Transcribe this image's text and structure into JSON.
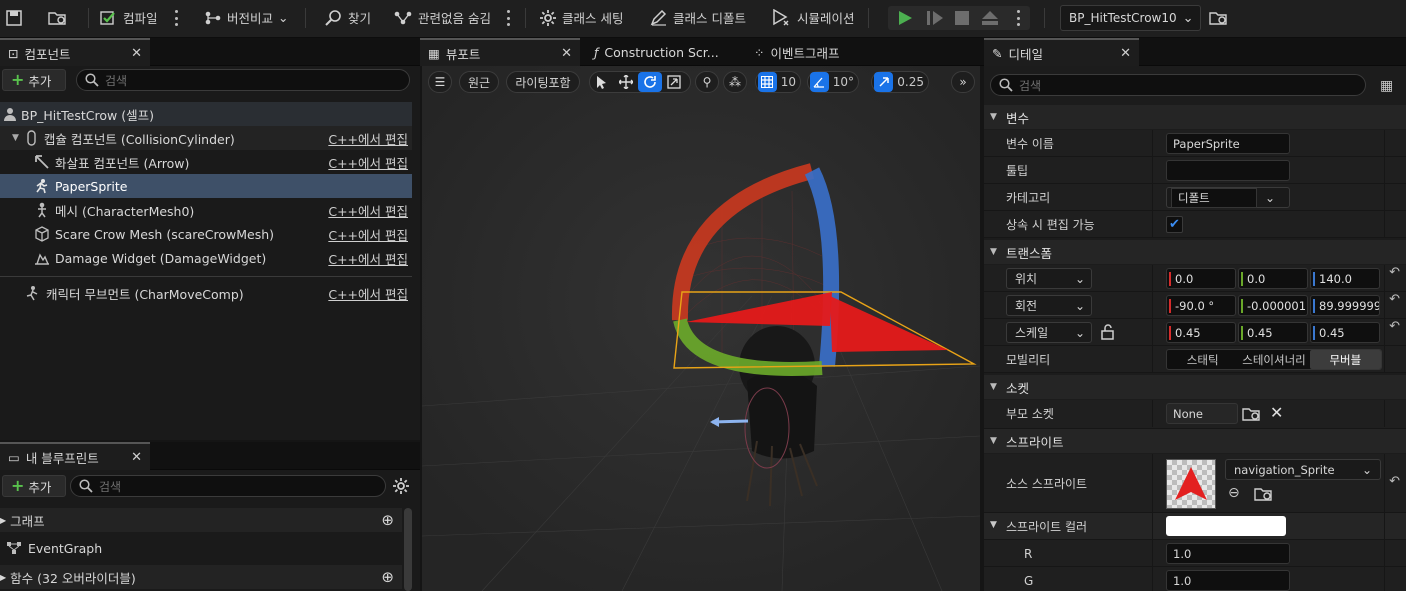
{
  "toolbar": {
    "compile": "컴파일",
    "diff": "버전비교",
    "find": "찾기",
    "hide_unrelated": "관련없음 숨김",
    "class_settings": "클래스 세팅",
    "class_defaults": "클래스 디폴트",
    "simulation": "시뮬레이션",
    "debug_object": "BP_HitTestCrow10"
  },
  "components_panel": {
    "tab_label": "컴포넌트",
    "add_label": "추가",
    "search_placeholder": "검색",
    "root_item": "BP_HitTestCrow (셀프)",
    "edit_label": "C++에서 편집",
    "items": [
      {
        "label": "캡슐 컴포넌트 (CollisionCylinder)",
        "edit": "C++에서 편집"
      },
      {
        "label": "화살표 컴포넌트 (Arrow)",
        "edit": "C++에서 편집"
      },
      {
        "label": "PaperSprite",
        "edit": ""
      },
      {
        "label": "메시 (CharacterMesh0)",
        "edit": "C++에서 편집"
      },
      {
        "label": "Scare Crow Mesh (scareCrowMesh)",
        "edit": "C++에서 편집"
      },
      {
        "label": "Damage Widget (DamageWidget)",
        "edit": "C++에서 편집"
      },
      {
        "label": "캐릭터 무브먼트 (CharMoveComp)",
        "edit": "C++에서 편집"
      }
    ]
  },
  "blueprint_panel": {
    "tab_label": "내 블루프린트",
    "add_label": "추가",
    "search_placeholder": "검색",
    "graph_section": "그래프",
    "event_graph": "EventGraph",
    "functions_section": "함수 (32 오버라이더블)"
  },
  "editor_tabs": {
    "viewport": "뷰포트",
    "construction": "Construction Scr...",
    "event_graph": "이벤트그래프"
  },
  "viewport_toolbar": {
    "perspective": "원근",
    "lighting": "라이팅포함",
    "grid_snap": "10",
    "rotation_snap": "10°",
    "scale_snap": "0.25"
  },
  "details": {
    "tab_label": "디테일",
    "search_placeholder": "검색",
    "variables_section": "변수",
    "var_name_label": "변수 이름",
    "var_name_value": "PaperSprite",
    "tooltip_label": "툴팁",
    "tooltip_value": "",
    "category_label": "카테고리",
    "category_value": "디폴트",
    "editable_label": "상속 시 편집 가능",
    "transform_section": "트랜스폼",
    "location_label": "위치",
    "location": [
      "0.0",
      "0.0",
      "140.0"
    ],
    "rotation_label": "회전",
    "rotation": [
      "-90.0 °",
      "-0.000001",
      "89.999999"
    ],
    "scale_label": "스케일",
    "scale": [
      "0.45",
      "0.45",
      "0.45"
    ],
    "mobility_label": "모빌리티",
    "mobility_options": [
      "스태틱",
      "스테이셔너리",
      "무버블"
    ],
    "mobility_selected": "무버블",
    "socket_section": "소켓",
    "parent_socket_label": "부모 소켓",
    "parent_socket_value": "None",
    "sprite_section": "스프라이트",
    "source_sprite_label": "소스 스프라이트",
    "source_sprite_value": "navigation_Sprite",
    "sprite_color_label": "스프라이트 컬러",
    "r_label": "R",
    "r_value": "1.0",
    "g_label": "G",
    "g_value": "1.0"
  },
  "colors": {
    "accent_blue": "#1a73e8",
    "play_green": "#4caf50",
    "axis_red": "#d62c2c",
    "axis_green": "#6aa82a",
    "axis_blue": "#3a78d0",
    "selection_orange": "#e8a317"
  }
}
